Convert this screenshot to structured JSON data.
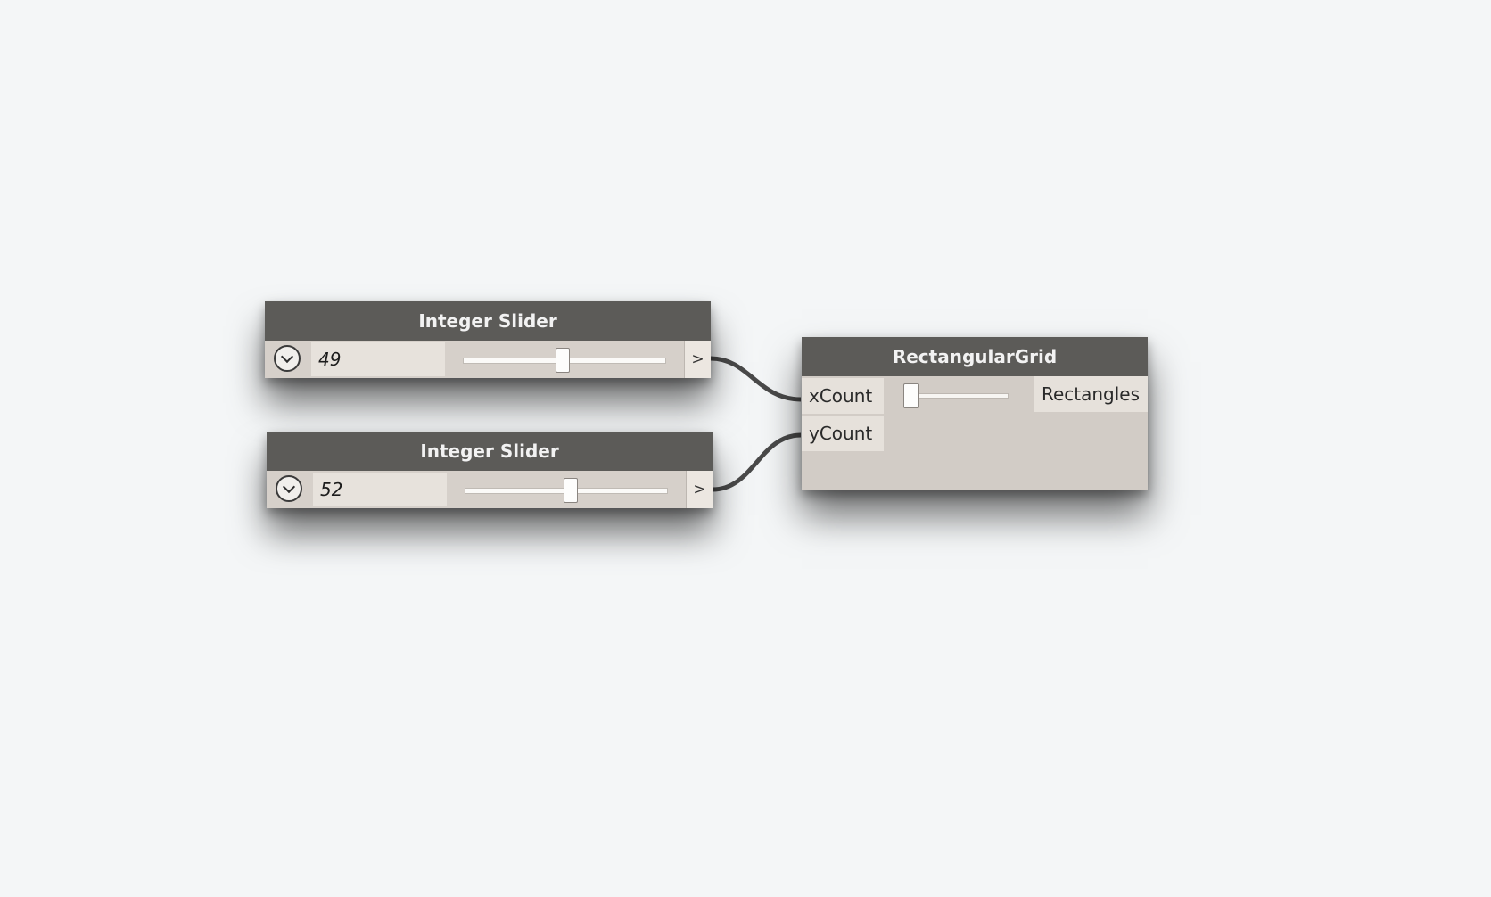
{
  "background": {
    "tile_color": "#5eb3d8",
    "canvas_color": "#f4f6f7"
  },
  "nodes": {
    "slider_x": {
      "title": "Integer Slider",
      "value": "49",
      "output_symbol": ">",
      "slider_fraction": 0.49,
      "expand_icon": "chevron-down-icon"
    },
    "slider_y": {
      "title": "Integer Slider",
      "value": "52",
      "output_symbol": ">",
      "slider_fraction": 0.52,
      "expand_icon": "chevron-down-icon"
    },
    "rect_grid": {
      "title": "RectangularGrid",
      "inputs": [
        "xCount",
        "yCount"
      ],
      "output": "Rectangles"
    }
  },
  "colors": {
    "node_header": "#5c5b58",
    "node_body": "#d2ccc6",
    "wire": "#4a4a4a"
  }
}
